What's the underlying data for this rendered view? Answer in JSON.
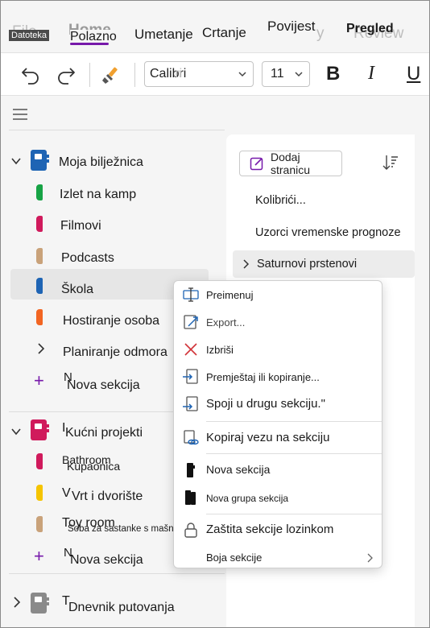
{
  "ribbon": {
    "file_tab_ghost": "File",
    "file_tab_label": "Datoteka",
    "home_tab_ghost": "Home",
    "home_tab": "Polazno",
    "insert_tab": "Umetanje",
    "draw_tab": "Crtanje",
    "history_tab": "Povijest",
    "history_ghost": "y",
    "review_tab": "Pregled",
    "review_ghost": "Review"
  },
  "toolbar": {
    "font_name": "Calibri",
    "font_name_ghost": "ri",
    "font_size": "11",
    "bold_label": "B",
    "italic_label": "I",
    "underline_label": "U"
  },
  "notebooks": [
    {
      "name": "Moja bilježnica",
      "color": "#1e64b4",
      "sections": [
        {
          "name": "Izlet na kamp",
          "ghost": "",
          "color": "#17a345"
        },
        {
          "name": "Filmovi",
          "ghost": "",
          "color": "#d01a5c"
        },
        {
          "name": "Podcasts",
          "ghost": "",
          "color": "#c9a27a"
        },
        {
          "name": "Škola",
          "ghost": "",
          "color": "#1e64b4"
        },
        {
          "name": "Hostiranje osoba",
          "ghost": "",
          "color": "#f26522"
        },
        {
          "name": "Planiranje odmora",
          "ghost": "",
          "color": ""
        }
      ],
      "new_section": "Nova sekcija",
      "new_section_ghost": "N"
    },
    {
      "name": "Kućni projekti",
      "name_ghost": "I",
      "color": "#d01a5c",
      "sections": [
        {
          "name": "Kupaonica",
          "ghost": "Bathroom",
          "color": "#d01a5c"
        },
        {
          "name": "Vrt i dvorište",
          "ghost": "V",
          "color": "#f5c400"
        },
        {
          "name": "Soba za sastanke s mašnama",
          "ghost": "Toy room",
          "color": "#c9a27a"
        }
      ],
      "new_section": "Nova sekcija",
      "new_section_ghost": "N"
    },
    {
      "name": "Dnevnik putovanja",
      "name_ghost": "T",
      "color": "#8a8a8a"
    }
  ],
  "pages_pane": {
    "add_page": "Dodaj stranicu",
    "pages": [
      "Kolibrići...",
      "Uzorci vremenske prognoze",
      "Saturnovi prstenovi"
    ]
  },
  "context_menu": {
    "items": [
      {
        "label": "Preimenuj",
        "ghost": ""
      },
      {
        "label": "Export...",
        "ghost": ""
      },
      {
        "label": "Izbriši",
        "ghost": "I"
      },
      {
        "label": "Premještaj ili kopiranje...",
        "ghost": "I"
      },
      {
        "label": "Spoji u drugu sekciju.\"",
        "ghost": "I"
      },
      {
        "label": "Kopiraj vezu na sekciju",
        "ghost": "C"
      },
      {
        "label": "Nova sekcija",
        "ghost": "I"
      },
      {
        "label": "Nova grupa sekcija",
        "ghost": "N"
      },
      {
        "label": "Zaštita sekcije lozinkom",
        "ghost": "P"
      },
      {
        "label": "Boja sekcije",
        "ghost": "S"
      }
    ]
  },
  "colors": {
    "accent": "#7719aa",
    "delete_red": "#d13438",
    "link_blue": "#1e64b4"
  }
}
